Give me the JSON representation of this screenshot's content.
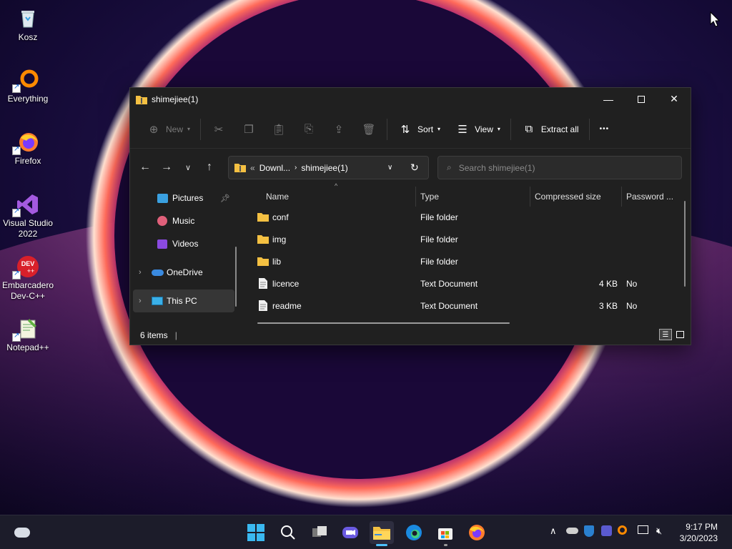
{
  "desktop": {
    "icons": [
      {
        "label": "Kosz",
        "icon": "recycle-bin-icon"
      },
      {
        "label": "Everything",
        "icon": "everything-search-icon"
      },
      {
        "label": "Firefox",
        "icon": "firefox-icon"
      },
      {
        "label": "Visual Studio\n2022",
        "icon": "visual-studio-icon"
      },
      {
        "label": "Embarcadero\nDev-C++",
        "icon": "devcpp-icon"
      },
      {
        "label": "Notepad++",
        "icon": "notepadpp-icon"
      }
    ]
  },
  "window": {
    "title": "shimejiee(1)",
    "toolbar": {
      "new_label": "New",
      "sort_label": "Sort",
      "view_label": "View",
      "extract_label": "Extract all",
      "more_label": "•••"
    },
    "address": {
      "overflow": "«",
      "segments": [
        "Downl...",
        "shimejiee(1)"
      ]
    },
    "search": {
      "placeholder": "Search shimejiee(1)"
    },
    "nav": {
      "items": [
        {
          "label": "Pictures",
          "pinned": true
        },
        {
          "label": "Music"
        },
        {
          "label": "Videos"
        },
        {
          "label": "OneDrive"
        },
        {
          "label": "This PC",
          "selected": true
        }
      ]
    },
    "columns": [
      "Name",
      "Type",
      "Compressed size",
      "Password ..."
    ],
    "files": [
      {
        "name": "conf",
        "type": "File folder",
        "size": "",
        "password": "",
        "kind": "folder"
      },
      {
        "name": "img",
        "type": "File folder",
        "size": "",
        "password": "",
        "kind": "folder"
      },
      {
        "name": "lib",
        "type": "File folder",
        "size": "",
        "password": "",
        "kind": "folder"
      },
      {
        "name": "licence",
        "type": "Text Document",
        "size": "4 KB",
        "password": "No",
        "kind": "text"
      },
      {
        "name": "readme",
        "type": "Text Document",
        "size": "3 KB",
        "password": "No",
        "kind": "text"
      }
    ],
    "status": "6 items"
  },
  "taskbar": {
    "time": "9:17 PM",
    "date": "3/20/2023"
  },
  "colors": {
    "accent": "#4cc2ff",
    "folder": "#f4c042",
    "window_bg": "#202020"
  }
}
